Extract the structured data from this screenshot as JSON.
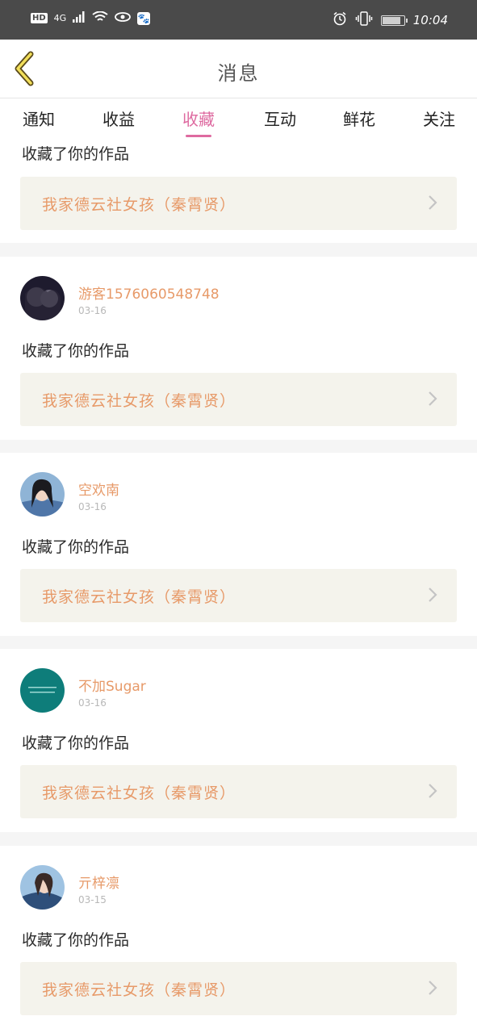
{
  "status_bar": {
    "hd": "HD",
    "network": "4G",
    "time": "10:04"
  },
  "header": {
    "title": "消息"
  },
  "tabs": [
    {
      "label": "通知"
    },
    {
      "label": "收益"
    },
    {
      "label": "收藏"
    },
    {
      "label": "互动"
    },
    {
      "label": "鲜花"
    },
    {
      "label": "关注"
    }
  ],
  "active_tab": "收藏",
  "colors": {
    "accent": "#de6aa0",
    "username": "#e79a69",
    "card_bg": "#f4f3ec"
  },
  "first_partial": {
    "action": "收藏了你的作品",
    "work": "我家德云社女孩（秦霄贤）"
  },
  "items": [
    {
      "username": "游客1576060548748",
      "date": "03-16",
      "action": "收藏了你的作品",
      "work": "我家德云社女孩（秦霄贤）",
      "avatar": "dark-anime-avatar"
    },
    {
      "username": "空欢南",
      "date": "03-16",
      "action": "收藏了你的作品",
      "work": "我家德云社女孩（秦霄贤）",
      "avatar": "girl-photo-avatar"
    },
    {
      "username": "不加Sugar",
      "date": "03-16",
      "action": "收藏了你的作品",
      "work": "我家德云社女孩（秦霄贤）",
      "avatar": "teal-text-avatar"
    },
    {
      "username": "亓梓凛",
      "date": "03-15",
      "action": "收藏了你的作品",
      "work": "我家德云社女孩（秦霄贤）",
      "avatar": "girl-sky-avatar"
    }
  ]
}
